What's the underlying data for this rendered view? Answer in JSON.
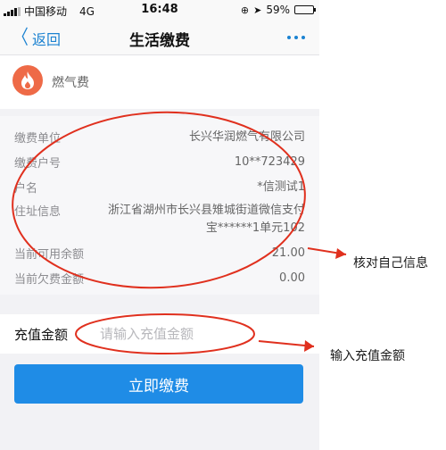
{
  "status_bar": {
    "carrier": "中国移动",
    "network": "4G",
    "time": "16:48",
    "battery_percent": "59%",
    "battery_level": 0.59
  },
  "nav": {
    "back_label": "返回",
    "title": "生活缴费"
  },
  "service": {
    "name": "燃气费",
    "icon": "flame-icon",
    "icon_color": "#ee6a47"
  },
  "info": {
    "rows": [
      {
        "label": "缴费单位",
        "value": "长兴华润燃气有限公司"
      },
      {
        "label": "缴费户号",
        "value": "10**723429"
      },
      {
        "label": "户名",
        "value": "*信测试1"
      },
      {
        "label": "住址信息",
        "value": "浙江省湖州市长兴县雉城街道微信支付\n宝******1单元102"
      },
      {
        "label": "当前可用余额",
        "value": "21.00"
      },
      {
        "label": "当前欠费金额",
        "value": "0.00"
      }
    ]
  },
  "recharge": {
    "label": "充值金额",
    "placeholder": "请输入充值金额",
    "value": ""
  },
  "pay_button": {
    "label": "立即缴费",
    "color": "#1f8ce6"
  },
  "annotations": {
    "verify_note": "核对自己信息",
    "input_note": "输入充值金额",
    "ink_color": "#e0301e"
  }
}
